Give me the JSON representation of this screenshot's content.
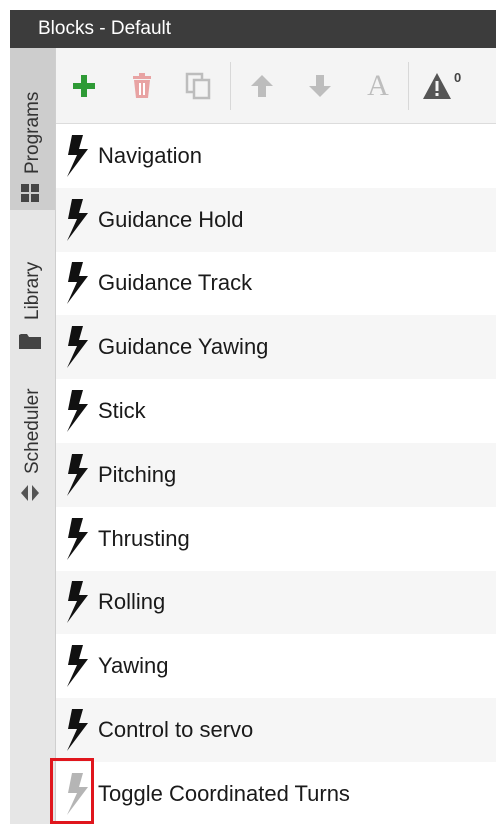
{
  "window": {
    "title": "Blocks - Default"
  },
  "sidebar": {
    "tabs": [
      {
        "label": "Programs",
        "icon": "grid-icon",
        "active": true
      },
      {
        "label": "Library",
        "icon": "folder-icon",
        "active": false
      },
      {
        "label": "Scheduler",
        "icon": "arrows-icon",
        "active": false
      }
    ]
  },
  "toolbar": {
    "warning_count": "0",
    "text_button_glyph": "A",
    "colors": {
      "add": "#2e9a35",
      "delete": "#e8a3a3",
      "disabled": "#bdbdbd",
      "warning": "#555555"
    }
  },
  "blocks": [
    {
      "label": "Navigation",
      "enabled": true
    },
    {
      "label": "Guidance Hold",
      "enabled": true
    },
    {
      "label": "Guidance Track",
      "enabled": true
    },
    {
      "label": "Guidance Yawing",
      "enabled": true
    },
    {
      "label": "Stick",
      "enabled": true
    },
    {
      "label": "Pitching",
      "enabled": true
    },
    {
      "label": "Thrusting",
      "enabled": true
    },
    {
      "label": "Rolling",
      "enabled": true
    },
    {
      "label": "Yawing",
      "enabled": true
    },
    {
      "label": "Control to servo",
      "enabled": true
    },
    {
      "label": "Toggle Coordinated Turns",
      "enabled": false
    }
  ],
  "highlight_color": "#e0161d"
}
